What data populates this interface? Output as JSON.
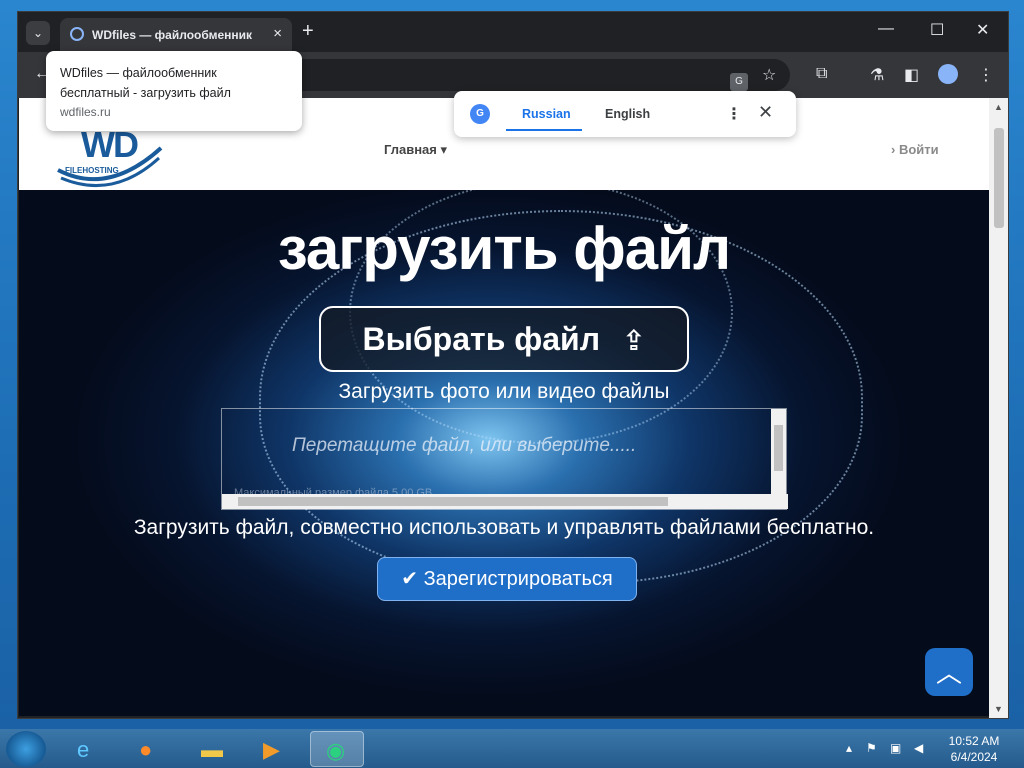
{
  "browser": {
    "tab_title": "WDfiles — файлообменник бесплатный - загрузить файл",
    "tab_close": "×",
    "new_tab": "+",
    "minimize": "—",
    "maximize": "☐",
    "close": "✕",
    "back": "←",
    "star": "☆",
    "extensions": "⧉",
    "flask": "⚗",
    "sidebar": "◧",
    "menu": "⋮"
  },
  "tooltip": {
    "title": "WDfiles — файлообменник бесплатный - загрузить файл",
    "url": "wdfiles.ru"
  },
  "translate": {
    "source_lang": "Russian",
    "target_lang": "English",
    "more": "⋮",
    "close": "✕"
  },
  "site": {
    "logo_text": "WD",
    "logo_sub": "FILEHOSTING",
    "nav": {
      "main": "Главная ▾",
      "login": "› Войти"
    }
  },
  "hero": {
    "title": "загрузить файл",
    "choose_button": "Выбрать файл",
    "subtitle": "Загрузить фото или видео файлы",
    "drop_text": "Перетащите файл, или выберите.....",
    "max_size": "Максимальный размер файла 5.00 GB",
    "description": "Загрузить файл, совместно использовать и управлять файлами бесплатно.",
    "register_button": "Зарегистрироваться"
  },
  "taskbar": {
    "time": "10:52 AM",
    "date": "6/4/2024"
  },
  "colors": {
    "accent": "#1f6ec8",
    "translate_blue": "#1a73e8"
  }
}
